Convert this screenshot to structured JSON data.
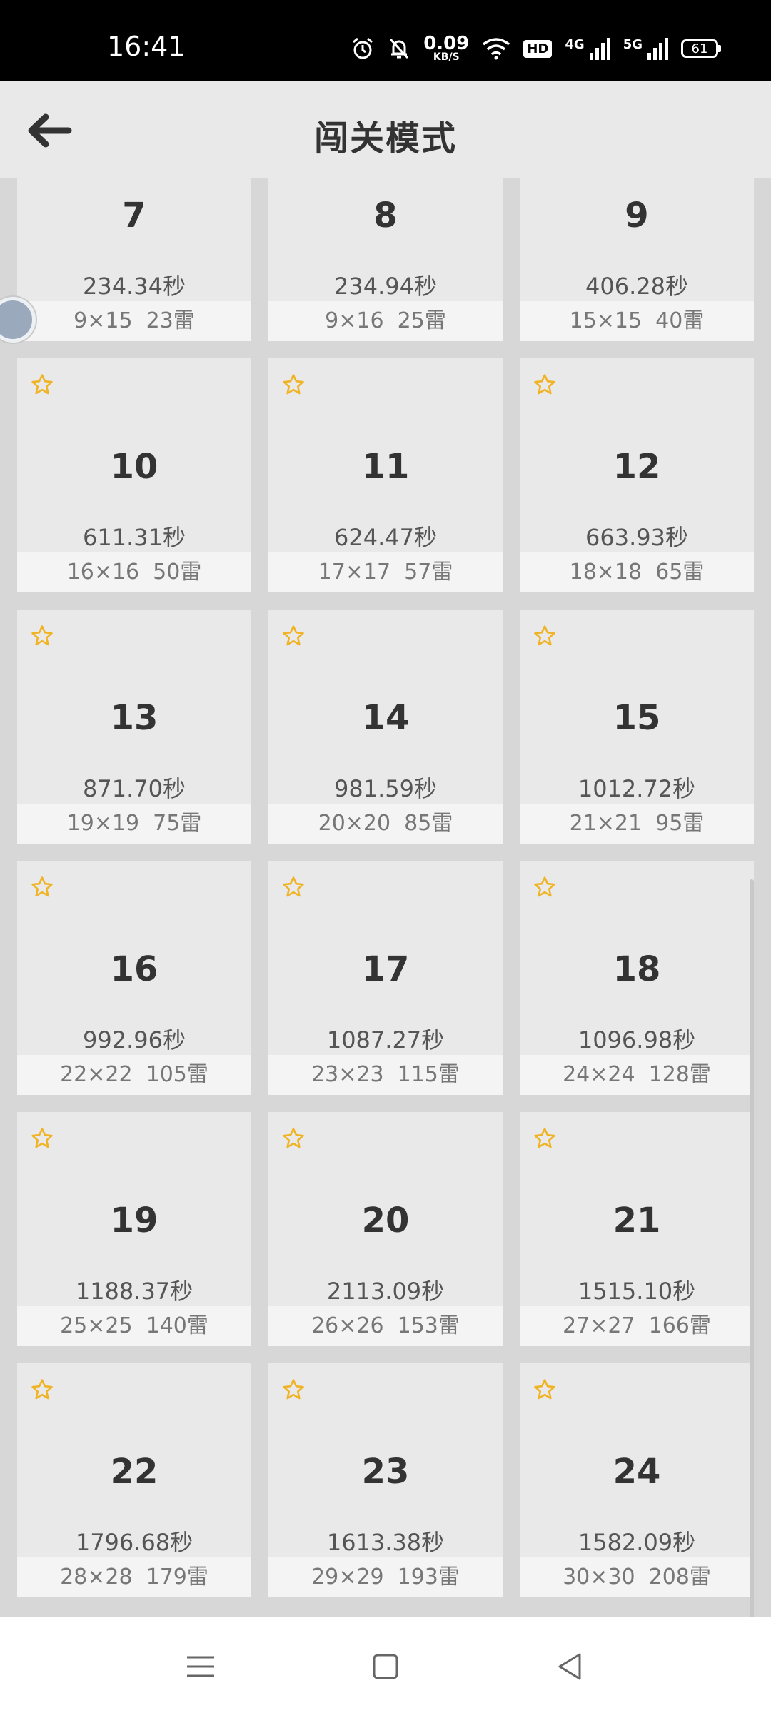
{
  "status": {
    "time": "16:41",
    "net_speed": "0.09",
    "net_unit": "KB/S",
    "hd": "HD",
    "net1": "4G",
    "net2": "5G",
    "battery": "61"
  },
  "header": {
    "title": "闯关模式"
  },
  "levels": [
    {
      "num": "7",
      "time": "234.34秒",
      "spec": "9×15  23雷",
      "star": false
    },
    {
      "num": "8",
      "time": "234.94秒",
      "spec": "9×16  25雷",
      "star": false
    },
    {
      "num": "9",
      "time": "406.28秒",
      "spec": "15×15  40雷",
      "star": false
    },
    {
      "num": "10",
      "time": "611.31秒",
      "spec": "16×16  50雷",
      "star": true
    },
    {
      "num": "11",
      "time": "624.47秒",
      "spec": "17×17  57雷",
      "star": true
    },
    {
      "num": "12",
      "time": "663.93秒",
      "spec": "18×18  65雷",
      "star": true
    },
    {
      "num": "13",
      "time": "871.70秒",
      "spec": "19×19  75雷",
      "star": true
    },
    {
      "num": "14",
      "time": "981.59秒",
      "spec": "20×20  85雷",
      "star": true
    },
    {
      "num": "15",
      "time": "1012.72秒",
      "spec": "21×21  95雷",
      "star": true
    },
    {
      "num": "16",
      "time": "992.96秒",
      "spec": "22×22  105雷",
      "star": true
    },
    {
      "num": "17",
      "time": "1087.27秒",
      "spec": "23×23  115雷",
      "star": true
    },
    {
      "num": "18",
      "time": "1096.98秒",
      "spec": "24×24  128雷",
      "star": true
    },
    {
      "num": "19",
      "time": "1188.37秒",
      "spec": "25×25  140雷",
      "star": true
    },
    {
      "num": "20",
      "time": "2113.09秒",
      "spec": "26×26  153雷",
      "star": true
    },
    {
      "num": "21",
      "time": "1515.10秒",
      "spec": "27×27  166雷",
      "star": true
    },
    {
      "num": "22",
      "time": "1796.68秒",
      "spec": "28×28  179雷",
      "star": true
    },
    {
      "num": "23",
      "time": "1613.38秒",
      "spec": "29×29  193雷",
      "star": true
    },
    {
      "num": "24",
      "time": "1582.09秒",
      "spec": "30×30  208雷",
      "star": true
    }
  ],
  "colors": {
    "star": "#f0b323",
    "card_bg": "#e9e9e9",
    "spec_bg": "#f4f4f4"
  },
  "icons": {
    "back": "arrow-left-icon",
    "star": "star-outline-icon",
    "menu": "menu-icon",
    "home": "square-home-icon",
    "nav_back": "triangle-back-icon"
  }
}
